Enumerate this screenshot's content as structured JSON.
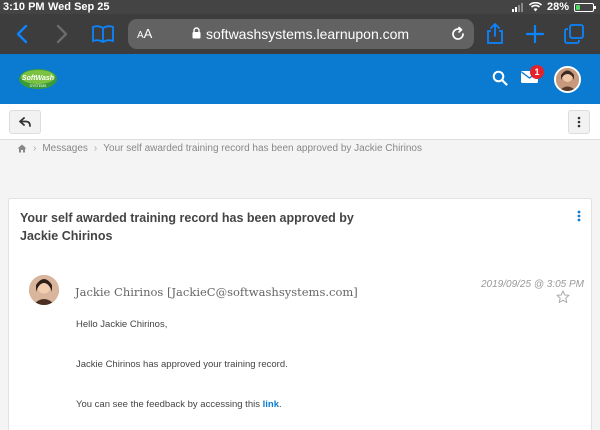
{
  "status_bar": {
    "time": "3:10 PM",
    "date": "Wed Sep 25",
    "battery": "28%",
    "battery_level": 0.28
  },
  "safari": {
    "text_size_label": "AA",
    "url": "softwashsystems.learnupon.com"
  },
  "header": {
    "notification_count": "1",
    "logo_alt": "SoftWash Systems"
  },
  "breadcrumb": {
    "messages": "Messages",
    "current": "Your self awarded training record has been approved by Jackie Chirinos"
  },
  "message": {
    "title": "Your self awarded training record has been approved by Jackie Chirinos",
    "sender": "Jackie Chirinos [JackieC@softwashsystems.com]",
    "timestamp": "2019/09/25 @ 3:05 PM",
    "greeting": "Hello Jackie Chirinos,",
    "line1": "Jackie Chirinos has approved your training record.",
    "line2_prefix": "You can see the feedback by accessing this ",
    "link_label": "link",
    "line2_suffix": "."
  },
  "colors": {
    "brand_blue": "#0a7bd1",
    "badge_red": "#e4222c",
    "toolbar_dark": "#3d3d3d"
  }
}
